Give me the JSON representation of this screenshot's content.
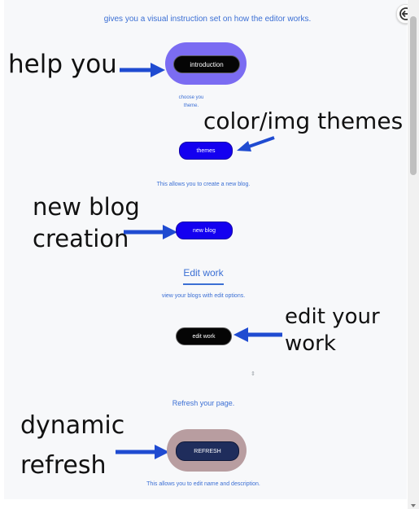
{
  "top_text": "gives you a visual instruction set on how the editor works.",
  "introduction": {
    "button_label": "introduction",
    "annotation": "help you"
  },
  "themes": {
    "description_line1": "choose you",
    "description_line2": "theme.",
    "button_label": "themes",
    "annotation": "color/img themes"
  },
  "new_blog": {
    "description": "This allows you to create a new blog.",
    "button_label": "new blog",
    "annotation_line1": "new blog",
    "annotation_line2": "creation"
  },
  "edit_work": {
    "heading": "Edit work",
    "description": "view your blogs with edit options.",
    "button_label": "edit work",
    "annotation_line1": "edit your",
    "annotation_line2": "work"
  },
  "refresh": {
    "description": "Refresh your page.",
    "button_label": "REFRESH",
    "annotation_line1": "dynamic",
    "annotation_line2": "refresh"
  },
  "bottom_text": "This allows you to edit name and description.",
  "small_glyph": "⇕",
  "icons": {
    "back": "back-arrow-icon"
  },
  "colors": {
    "accent_text": "#3b6fd4",
    "introduction_blob": "#7b6cf2",
    "refresh_blob": "#b89da0",
    "annotation_arrow": "#1f4bd1"
  }
}
